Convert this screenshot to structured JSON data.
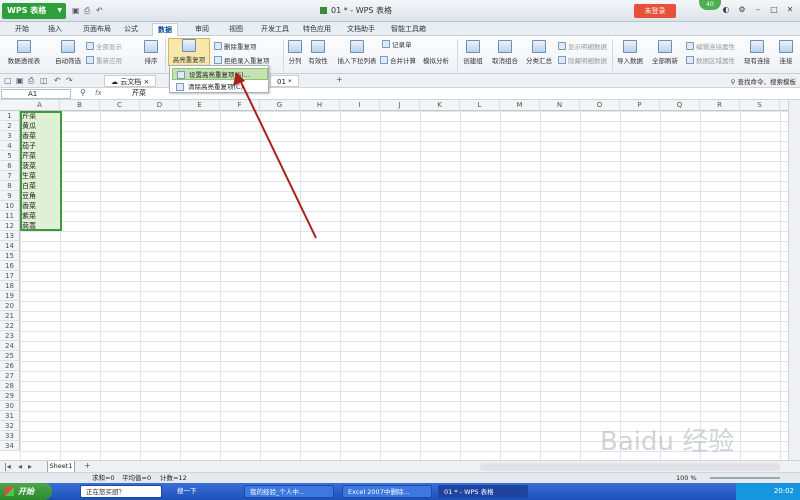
{
  "app": {
    "name": "WPS 表格",
    "window_title": "01 * - WPS 表格",
    "login": "未登录",
    "badge": "40"
  },
  "tabs": [
    "开始",
    "插入",
    "页面布局",
    "公式",
    "数据",
    "审阅",
    "视图",
    "开发工具",
    "特色应用",
    "文档助手",
    "智能工具箱"
  ],
  "active_tab": "数据",
  "ribbon": {
    "pivot": "数据透视表",
    "autofilter": "自动筛选",
    "show_all": "全部显示",
    "reapply": "重新应用",
    "sort": "排序",
    "highlight_dup": "高亮重复项",
    "remove_dup": "删除重复项",
    "reject_dup": "拒绝录入重复项",
    "split": "分列",
    "validity": "有效性",
    "insert_dropdown": "插入下拉列表",
    "records": "记录单",
    "merge_calc": "合并计算",
    "simulate": "模拟分析",
    "group": "创建组",
    "ungroup": "取消组合",
    "subtotal": "分类汇总",
    "show_detail": "显示明细数据",
    "hide_detail": "隐藏明细数据",
    "import": "导入数据",
    "refresh_all": "全部刷新",
    "edit_query": "编辑连接属性",
    "data_range": "数据区域属性",
    "existing_conn": "现有连接",
    "conn": "连接"
  },
  "dropdown": {
    "item1": "设置高亮重复项(S)...",
    "item2": "清除高亮重复项(C)"
  },
  "doc_tabs": {
    "cloud": "云文档",
    "file": "01 *"
  },
  "search_placeholder": "查找命令、搜索模板",
  "formula_bar": {
    "cell": "A1",
    "fx": "fx",
    "value": "芹菜"
  },
  "columns": [
    "A",
    "B",
    "C",
    "D",
    "E",
    "F",
    "G",
    "H",
    "I",
    "J",
    "K",
    "L",
    "M",
    "N",
    "O",
    "P",
    "Q",
    "R",
    "S"
  ],
  "rows": [
    "1",
    "2",
    "3",
    "4",
    "5",
    "6",
    "7",
    "8",
    "9",
    "10",
    "11",
    "12",
    "13",
    "14",
    "15",
    "16",
    "17",
    "18",
    "19",
    "20",
    "21",
    "22",
    "23",
    "24",
    "25",
    "26",
    "27",
    "28",
    "29",
    "30",
    "31",
    "32",
    "33",
    "34"
  ],
  "cells_a": [
    "芹菜",
    "黄瓜",
    "香菜",
    "茄子",
    "芹菜",
    "菠菜",
    "生菜",
    "白菜",
    "豆角",
    "香菜",
    "紫菜",
    "茼蒿"
  ],
  "sheet": "Sheet1",
  "status": {
    "sum": "求和=0",
    "avg": "平均值=0",
    "count": "计数=12",
    "zoom": "100 %"
  },
  "taskbar": {
    "start": "开始",
    "ie": "正在怒买厨？",
    "search": "搜一下",
    "item1": "我的经验_个人中...",
    "item2": "Excel 2007中删除...",
    "item3": "01 * - WPS 表格",
    "time": "20:02"
  },
  "watermark": "Baidu 经验"
}
